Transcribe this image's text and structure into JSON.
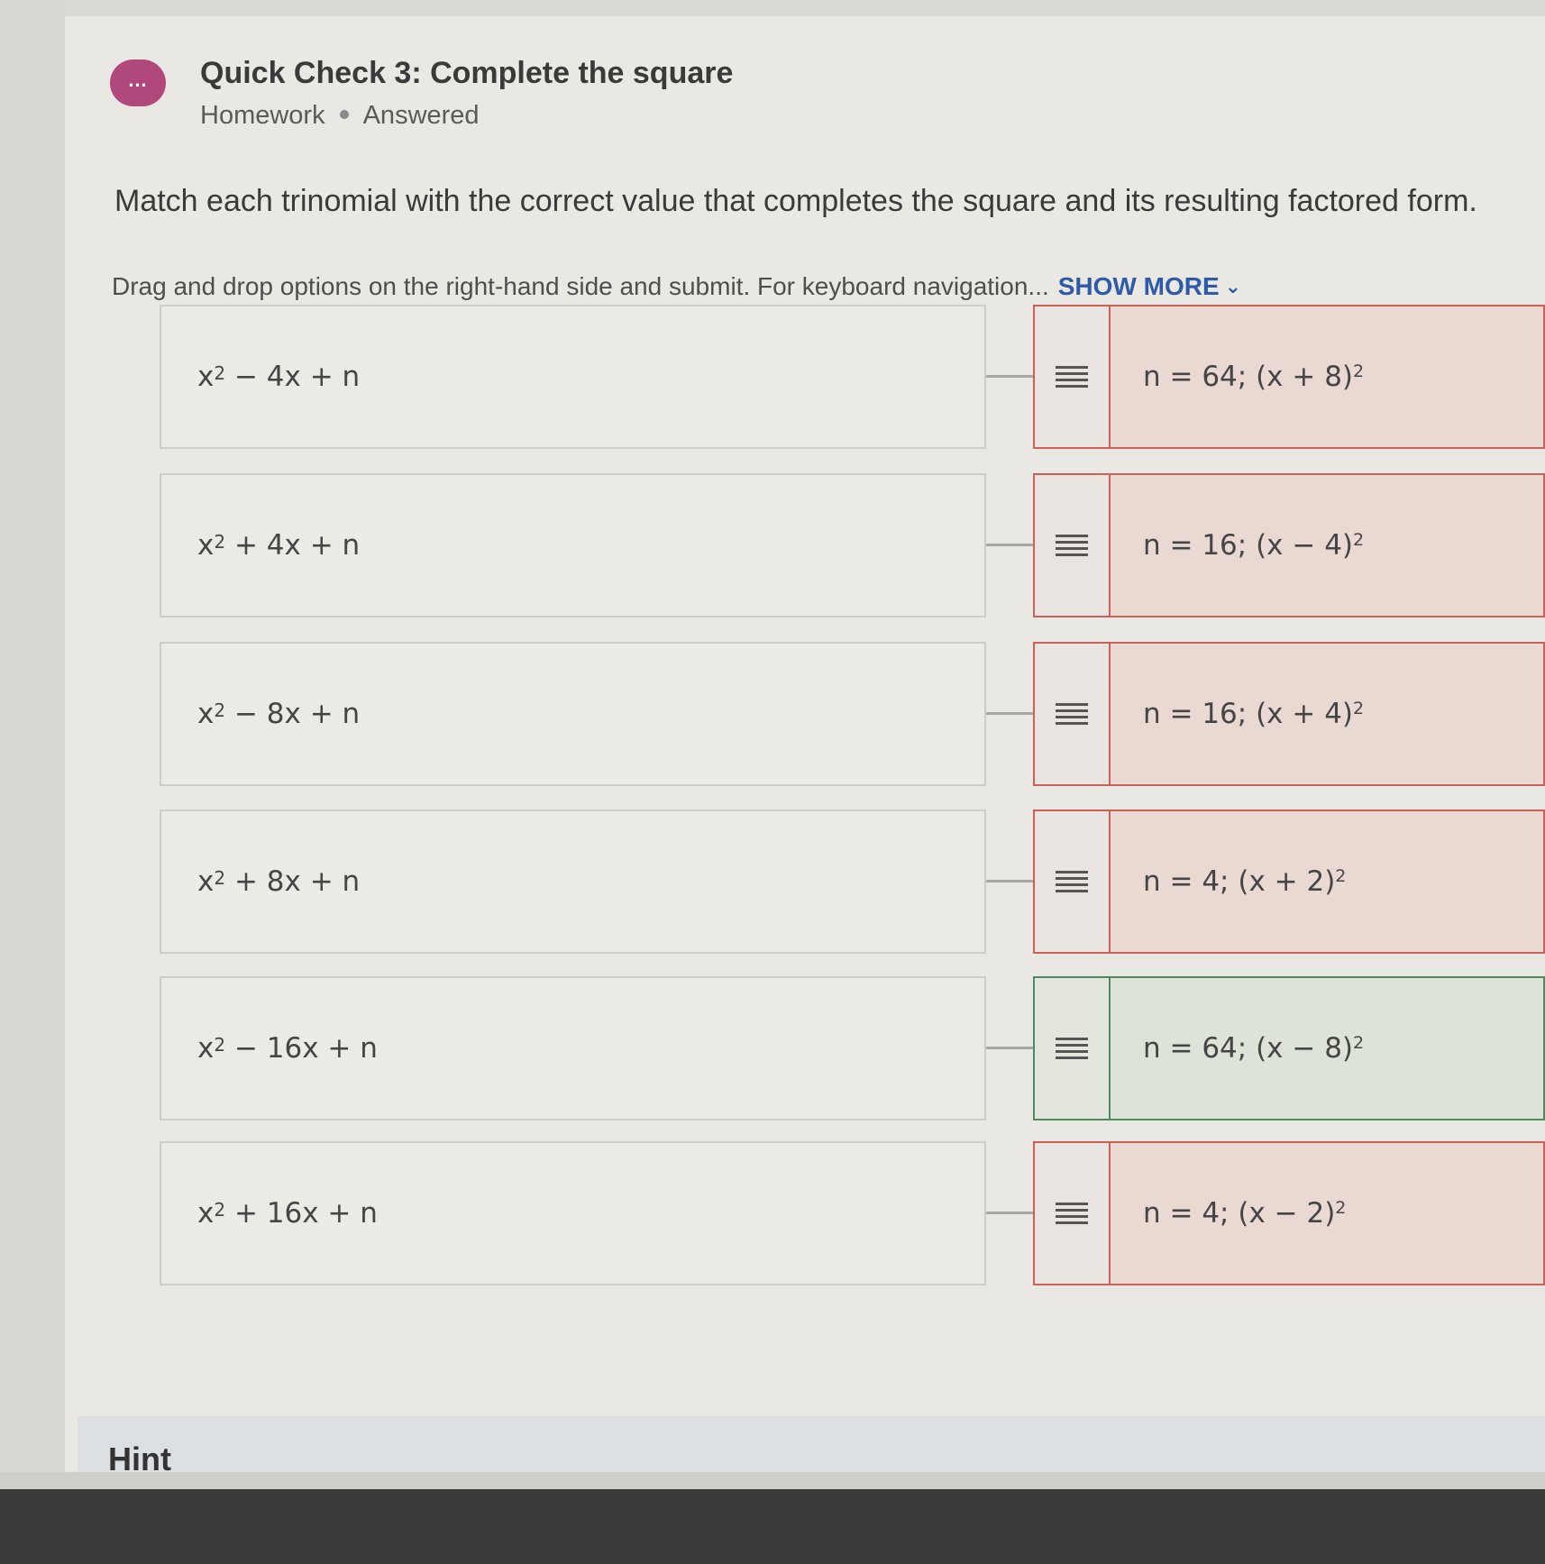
{
  "header": {
    "avatar_icon": "chat-bubble-icon",
    "avatar_text": "…",
    "title": "Quick Check 3: Complete the square",
    "category": "Homework",
    "status": "Answered"
  },
  "question": {
    "prompt": "Match each trinomial with the correct value that completes the square and its resulting factored form.",
    "instructions": "Drag and drop options on the right-hand side and submit. For keyboard navigation...",
    "show_more": "SHOW MORE",
    "show_more_icon": "chevron-down-icon"
  },
  "rows": [
    {
      "trinomial": {
        "base": "x",
        "exp": "2",
        "rest": " − 4x + n"
      },
      "answer": {
        "text": "n = 64; (x + 8)",
        "exp": "2"
      },
      "result": "incorrect"
    },
    {
      "trinomial": {
        "base": "x",
        "exp": "2",
        "rest": " + 4x + n"
      },
      "answer": {
        "text": "n = 16; (x − 4)",
        "exp": "2"
      },
      "result": "incorrect"
    },
    {
      "trinomial": {
        "base": "x",
        "exp": "2",
        "rest": " − 8x + n"
      },
      "answer": {
        "text": "n = 16; (x + 4)",
        "exp": "2"
      },
      "result": "incorrect"
    },
    {
      "trinomial": {
        "base": "x",
        "exp": "2",
        "rest": " + 8x + n"
      },
      "answer": {
        "text": "n = 4; (x + 2)",
        "exp": "2"
      },
      "result": "incorrect"
    },
    {
      "trinomial": {
        "base": "x",
        "exp": "2",
        "rest": " − 16x + n"
      },
      "answer": {
        "text": "n = 64; (x − 8)",
        "exp": "2"
      },
      "result": "correct"
    },
    {
      "trinomial": {
        "base": "x",
        "exp": "2",
        "rest": " + 16x + n"
      },
      "answer": {
        "text": "n = 4; (x − 2)",
        "exp": "2"
      },
      "result": "incorrect"
    }
  ],
  "colors": {
    "correct": "#4e8a5e",
    "incorrect": "#c9605a",
    "link": "#2f5aa8",
    "avatar": "#b0487c"
  },
  "footer": {
    "hint_label": "Hint"
  }
}
